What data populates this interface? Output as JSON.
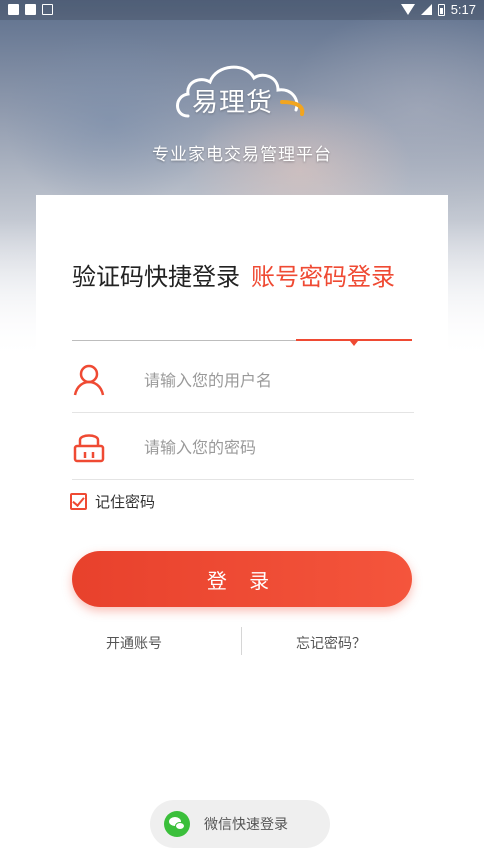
{
  "status_bar": {
    "time": "5:17"
  },
  "logo": {
    "text": "易理货"
  },
  "slogan": "专业家电交易管理平台",
  "tabs": {
    "sms_login": "验证码快捷登录",
    "password_login": "账号密码登录",
    "active": "password_login"
  },
  "username": {
    "placeholder": "请输入您的用户名",
    "value": ""
  },
  "password": {
    "placeholder": "请输入您的密码",
    "value": ""
  },
  "remember": {
    "label": "记住密码",
    "checked": true
  },
  "login_button": "登 录",
  "links": {
    "open_account": "开通账号",
    "forgot_password": "忘记密码？"
  },
  "wechat_login": "微信快速登录",
  "colors": {
    "accent": "#ef4a33",
    "wechat_green": "#3bbf3b"
  }
}
